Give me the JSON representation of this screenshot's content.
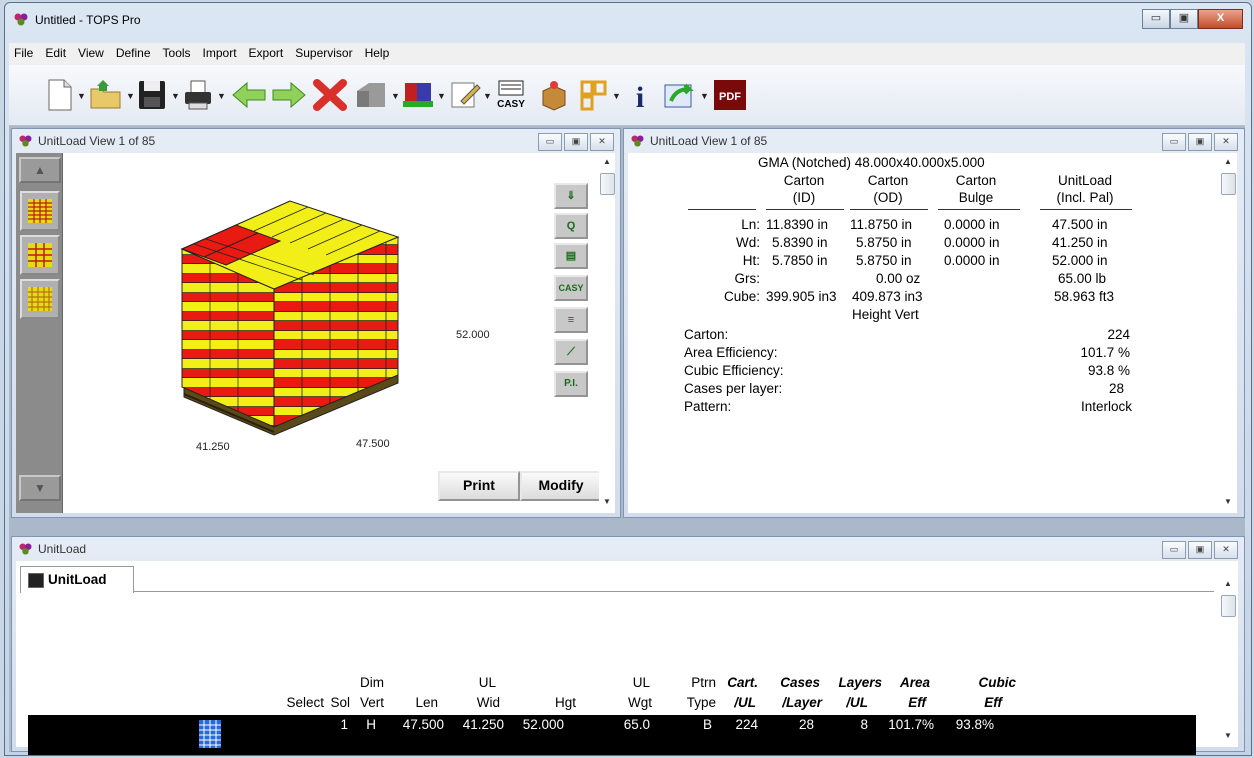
{
  "app": {
    "title": "Untitled - TOPS Pro"
  },
  "window_buttons": {
    "minimize": "▭",
    "maximize": "▣",
    "close": "X"
  },
  "menu": [
    "File",
    "Edit",
    "View",
    "Define",
    "Tools",
    "Import",
    "Export",
    "Supervisor",
    "Help"
  ],
  "toolbar": {
    "icons": [
      "new-document-icon",
      "open-folder-icon",
      "save-disk-icon",
      "print-icon",
      "back-arrow-icon",
      "forward-arrow-icon",
      "delete-x-icon",
      "stack-icon",
      "pallet-load-icon",
      "edit-notes-icon",
      "casy-icon",
      "box-star-icon",
      "layout-grid-icon",
      "info-icon",
      "export-icon",
      "pdf-icon"
    ],
    "casy_label": "CASY",
    "info_label": "i",
    "pdf_label": "PDF"
  },
  "child_buttons": {
    "minimize": "▭",
    "restore": "▣",
    "close": "✕"
  },
  "view_left": {
    "title": "UnitLoad View 1 of 85",
    "dims": {
      "height": "52.000",
      "width": "41.250",
      "length": "47.500"
    },
    "tools": [
      "⇓",
      "Q",
      "▤",
      "CASY",
      "≡",
      "⟋",
      "P.I."
    ],
    "print_label": "Print",
    "modify_label": "Modify"
  },
  "view_right": {
    "title": "UnitLoad View 1 of 85",
    "heading": "GMA (Notched) 48.000x40.000x5.000",
    "columns": [
      {
        "line1": "Carton",
        "line2": "(ID)"
      },
      {
        "line1": "Carton",
        "line2": "(OD)"
      },
      {
        "line1": "Carton",
        "line2": "Bulge"
      },
      {
        "line1": "UnitLoad",
        "line2": "(Incl. Pal)"
      }
    ],
    "rows": [
      {
        "label": "Ln:",
        "v": [
          "11.8390 in",
          "11.8750 in",
          "0.0000 in",
          "47.500 in"
        ]
      },
      {
        "label": "Wd:",
        "v": [
          "5.8390 in",
          "5.8750 in",
          "0.0000 in",
          "41.250 in"
        ]
      },
      {
        "label": "Ht:",
        "v": [
          "5.7850 in",
          "5.8750 in",
          "0.0000 in",
          "52.000 in"
        ]
      },
      {
        "label": "Grs:",
        "v": [
          "",
          "0.00 oz",
          "",
          "65.00 lb"
        ]
      },
      {
        "label": "Cube:",
        "v": [
          "399.905 in3",
          "409.873 in3",
          "",
          "58.963 ft3"
        ]
      }
    ],
    "orientation": "Height Vert",
    "summary": [
      {
        "label": "Carton:",
        "value": "224"
      },
      {
        "label": "Area Efficiency:",
        "value": "101.7 %"
      },
      {
        "label": "Cubic Efficiency:",
        "value": "93.8 %"
      },
      {
        "label": "Cases per layer:",
        "value": "28"
      },
      {
        "label": "Pattern:",
        "value": "Interlock"
      }
    ]
  },
  "bottom": {
    "title": "UnitLoad",
    "tab": "UnitLoad",
    "headers": [
      {
        "l1": "",
        "l2": "Select"
      },
      {
        "l1": "",
        "l2": "Sol"
      },
      {
        "l1": "Dim",
        "l2": "Vert"
      },
      {
        "l1": "",
        "l2": "Len"
      },
      {
        "l1": "UL",
        "l2": "Wid"
      },
      {
        "l1": "",
        "l2": "Hgt"
      },
      {
        "l1": "UL",
        "l2": "Wgt"
      },
      {
        "l1": "Ptrn",
        "l2": "Type"
      },
      {
        "l1": "Cart.",
        "l2": "/UL"
      },
      {
        "l1": "Cases",
        "l2": "/Layer"
      },
      {
        "l1": "Layers",
        "l2": "/UL"
      },
      {
        "l1": "Area",
        "l2": "Eff"
      },
      {
        "l1": "Cubic",
        "l2": "Eff"
      }
    ],
    "row": [
      "",
      "1",
      "H",
      "47.500",
      "41.250",
      "52.000",
      "65.0",
      "B",
      "224",
      "28",
      "8",
      "101.7%",
      "93.8%"
    ]
  }
}
